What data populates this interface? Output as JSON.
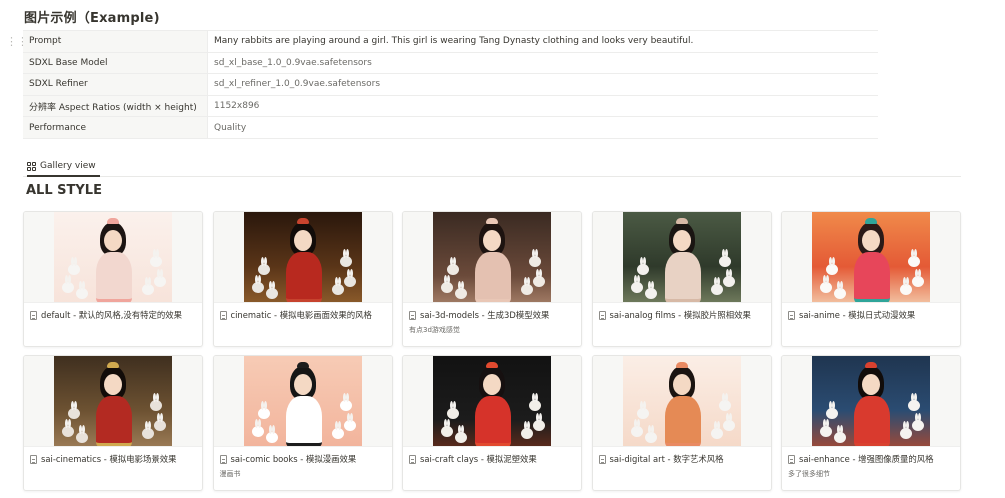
{
  "page": {
    "title": "图片示例（Example)"
  },
  "properties": [
    {
      "key": "Prompt",
      "value": "Many rabbits are playing around a girl. This girl is wearing Tang Dynasty clothing and looks very beautiful."
    },
    {
      "key": "SDXL Base Model",
      "value": "sd_xl_base_1.0_0.9vae.safetensors"
    },
    {
      "key": "SDXL Refiner",
      "value": "sd_xl_refiner_1.0_0.9vae.safetensors"
    },
    {
      "key": "分辨率 Aspect Ratios (width × height)",
      "value": "1152x896"
    },
    {
      "key": "Performance",
      "value": "Quality"
    }
  ],
  "view": {
    "tab_label": "Gallery view"
  },
  "section": {
    "title": "ALL STYLE"
  },
  "gallery": [
    {
      "title": "default - 默认的风格,没有特定的效果",
      "subtitle": "",
      "thumb": "default"
    },
    {
      "title": "cinematic - 模拟电影画面效果的风格",
      "subtitle": "",
      "thumb": "cinematic"
    },
    {
      "title": "sai-3d-models - 生成3D模型效果",
      "subtitle": "有点3d游戏感觉",
      "thumb": "3d"
    },
    {
      "title": "sai-analog films - 模拟胶片照相效果",
      "subtitle": "",
      "thumb": "analog"
    },
    {
      "title": "sai-anime - 模拟日式动漫效果",
      "subtitle": "",
      "thumb": "anime"
    },
    {
      "title": "sai-cinematics - 模拟电影场景效果",
      "subtitle": "",
      "thumb": "cinematics"
    },
    {
      "title": "sai-comic books - 模拟漫画效果",
      "subtitle": "漫画书",
      "thumb": "comic"
    },
    {
      "title": "sai-craft clays - 模拟泥塑效果",
      "subtitle": "",
      "thumb": "clay"
    },
    {
      "title": "sai-digital art - 数字艺术风格",
      "subtitle": "",
      "thumb": "digital"
    },
    {
      "title": "sai-enhance - 增强图像质量的风格",
      "subtitle": "多了很多细节",
      "thumb": "enhance"
    }
  ],
  "colors": {
    "text": "#37352f",
    "muted": "#6b6a66",
    "border": "#ededec",
    "key_bg": "#f7f7f5"
  }
}
